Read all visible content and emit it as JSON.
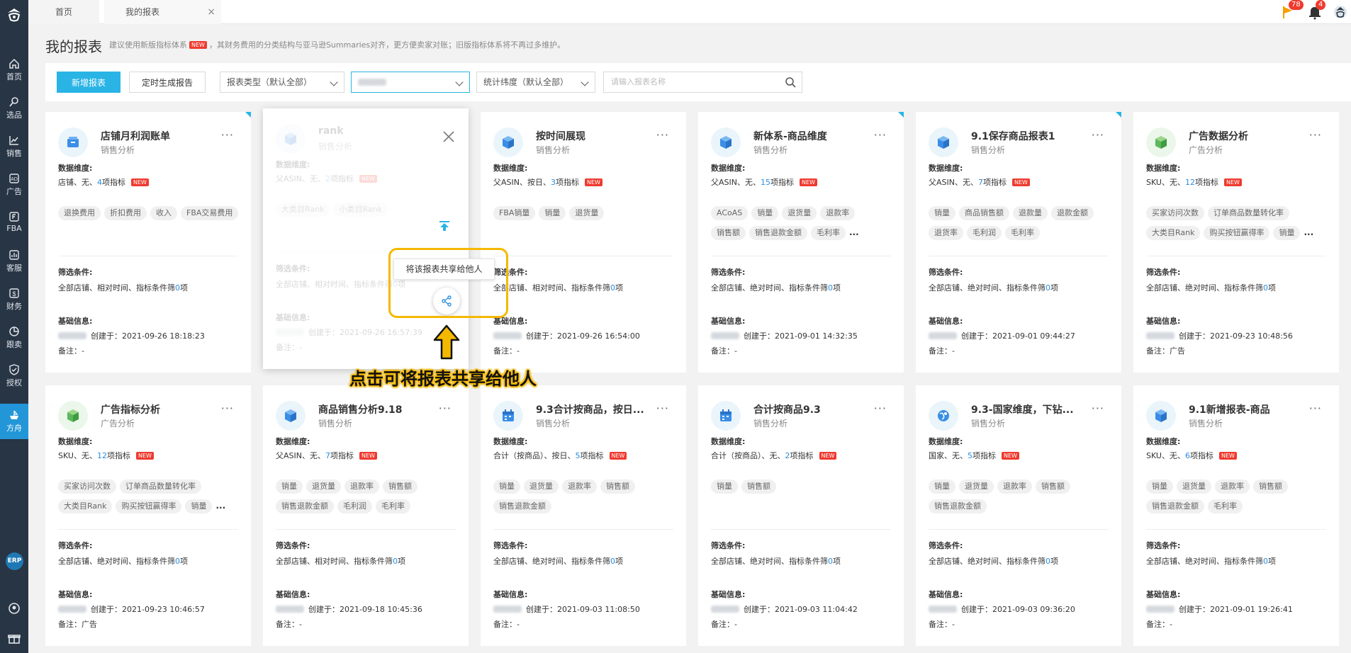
{
  "sidebar": {
    "items": [
      {
        "label": "首页",
        "icon": "home-icon"
      },
      {
        "label": "选品",
        "icon": "search-icon"
      },
      {
        "label": "销售",
        "icon": "chart-icon"
      },
      {
        "label": "广告",
        "icon": "ad-icon"
      },
      {
        "label": "FBA",
        "icon": "fba-icon"
      },
      {
        "label": "客服",
        "icon": "service-icon"
      },
      {
        "label": "财务",
        "icon": "finance-icon"
      },
      {
        "label": "跟卖",
        "icon": "pie-icon"
      },
      {
        "label": "授权",
        "icon": "shield-icon"
      },
      {
        "label": "方舟",
        "icon": "ark-icon"
      }
    ],
    "erp": "ERP"
  },
  "tabs": {
    "home": "首页",
    "reports": "我的报表",
    "close": "×"
  },
  "topbar": {
    "flag_badge": "78",
    "bell_badge": "4"
  },
  "page": {
    "title": "我的报表",
    "notice_prefix": "建议使用新版指标体系",
    "new_tag": "NEW",
    "notice_suffix": "，其财务费用的分类结构与亚马逊Summaries对齐，更方便卖家对账；旧版指标体系将不再过多维护。"
  },
  "toolbar": {
    "add": "新增报表",
    "schedule": "定时生成报告",
    "type_select": "报表类型（默认全部）",
    "dim_select": "统计纬度（默认全部）",
    "search_placeholder": "请输入报表名称"
  },
  "labels": {
    "dims": "数据维度:",
    "filter": "筛选条件:",
    "base": "基础信息:",
    "metrics_suffix": "项指标",
    "filter_prefix": "指标条件筛",
    "filter_suffix": "项",
    "note_prefix": "备注：",
    "created_prefix": "创建于：",
    "new": "NEW"
  },
  "cards": [
    {
      "title": "店铺月利润账单",
      "subtitle": "销售分析",
      "dim": "店铺、无、",
      "count": "4",
      "tags": [
        "退换费用",
        "折扣费用",
        "收入",
        "FBA交易费用"
      ],
      "filter": "全部店铺、相对时间、",
      "fcount": "0",
      "created": "2021-09-26 18:18:23",
      "note": "-",
      "icon": "box-icon"
    },
    {
      "title": "rank",
      "subtitle": "销售分析",
      "dim": "父ASIN、无、",
      "count": "2",
      "tags": [
        "大类目Rank",
        "小类目Rank"
      ],
      "filter": "全部店铺、相对时间、",
      "fcount": "0",
      "created": "2021-09-26 16:57:39",
      "note": "-",
      "icon": "cube-icon"
    },
    {
      "title": "按时间展现",
      "subtitle": "销售分析",
      "dim": "父ASIN、按日、",
      "count": "3",
      "tags": [
        "FBA销量",
        "销量",
        "退货量"
      ],
      "filter": "全部店铺、相对时间、",
      "fcount": "0",
      "created": "2021-09-26 16:54:00",
      "note": "-",
      "icon": "cube-icon"
    },
    {
      "title": "新体系-商品维度",
      "subtitle": "销售分析",
      "dim": "父ASIN、无、",
      "count": "15",
      "tags": [
        "ACoAS",
        "销量",
        "退货量",
        "退款率",
        "销售额",
        "销售退款金额",
        "毛利率"
      ],
      "more": true,
      "filter": "全部店铺、绝对时间、",
      "fcount": "0",
      "created": "2021-09-01 14:32:35",
      "note": "-",
      "icon": "cube-icon"
    },
    {
      "title": "9.1保存商品报表1",
      "subtitle": "销售分析",
      "dim": "父ASIN、无、",
      "count": "7",
      "tags": [
        "销量",
        "商品销售额",
        "退款量",
        "退款金额",
        "退货率",
        "毛利润",
        "毛利率"
      ],
      "filter": "全部店铺、绝对时间、",
      "fcount": "0",
      "created": "2021-09-01 09:44:27",
      "note": "-",
      "icon": "cube-icon"
    },
    {
      "title": "广告数据分析",
      "subtitle": "广告分析",
      "dim": "SKU、无、",
      "count": "12",
      "tags": [
        "买家访问次数",
        "订单商品数量转化率",
        "大类目Rank",
        "购买按钮赢得率",
        "销量"
      ],
      "more": true,
      "filter": "全部店铺、绝对时间、",
      "fcount": "0",
      "created": "2021-09-23 10:48:56",
      "note": "广告",
      "icon": "cube-icon"
    },
    {
      "title": "广告指标分析",
      "subtitle": "广告分析",
      "dim": "SKU、无、",
      "count": "12",
      "tags": [
        "买家访问次数",
        "订单商品数量转化率",
        "大类目Rank",
        "购买按钮赢得率",
        "销量"
      ],
      "more": true,
      "filter": "全部店铺、绝对时间、",
      "fcount": "0",
      "created": "2021-09-23 10:46:57",
      "note": "广告",
      "icon": "cube-icon"
    },
    {
      "title": "商品销售分析9.18",
      "subtitle": "销售分析",
      "dim": "父ASIN、无、",
      "count": "7",
      "tags": [
        "销量",
        "退货量",
        "退款率",
        "销售额",
        "销售退款金额",
        "毛利润",
        "毛利率"
      ],
      "filter": "全部店铺、相对时间、",
      "fcount": "0",
      "created": "2021-09-18 10:45:36",
      "note": "-",
      "icon": "cube-icon"
    },
    {
      "title": "9.3合计按商品，按日...",
      "subtitle": "销售分析",
      "dim": "合计（按商品）、按日、",
      "count": "5",
      "tags": [
        "销量",
        "退货量",
        "退款率",
        "销售额",
        "销售退款金额"
      ],
      "filter": "全部店铺、绝对时间、",
      "fcount": "0",
      "created": "2021-09-03 11:08:50",
      "note": "-",
      "icon": "calendar-icon"
    },
    {
      "title": "合计按商品9.3",
      "subtitle": "销售分析",
      "dim": "合计（按商品）、无、",
      "count": "2",
      "tags": [
        "销量",
        "销售额"
      ],
      "filter": "全部店铺、绝对时间、",
      "fcount": "0",
      "created": "2021-09-03 11:04:42",
      "note": "-",
      "icon": "calendar-icon"
    },
    {
      "title": "9.3-国家维度，下钻...",
      "subtitle": "销售分析",
      "dim": "国家、无、",
      "count": "5",
      "tags": [
        "销量",
        "退货量",
        "退款率",
        "销售额",
        "销售退款金额"
      ],
      "filter": "全部店铺、绝对时间、",
      "fcount": "0",
      "created": "2021-09-03 09:36:20",
      "note": "-",
      "icon": "globe-icon"
    },
    {
      "title": "9.1新增报表-商品",
      "subtitle": "销售分析",
      "dim": "SKU、无、",
      "count": "6",
      "tags": [
        "销量",
        "退货量",
        "退款率",
        "销售额",
        "销售退款金额",
        "毛利率"
      ],
      "filter": "全部店铺、绝对时间、",
      "fcount": "0",
      "created": "2021-09-01 19:26:41",
      "note": "-",
      "icon": "cube-icon"
    }
  ],
  "share": {
    "tooltip": "将该报表共享给他人",
    "callout": "点击可将报表共享给他人"
  },
  "colors": {
    "accent": "#2ab4e6",
    "sidebar": "#283544",
    "highlight": "#f5b800",
    "new": "#ef3a2f"
  }
}
